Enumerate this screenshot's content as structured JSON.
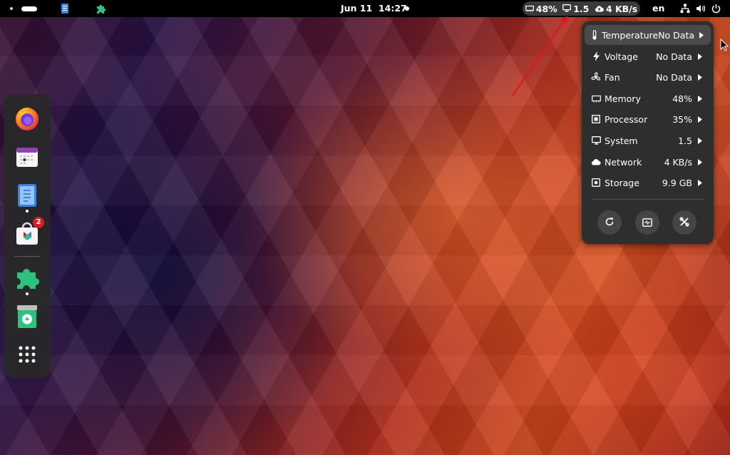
{
  "topbar": {
    "clock_date": "Jun 11",
    "clock_time": "14:27",
    "monitor": {
      "memory": "48%",
      "system": "1.5",
      "network": "4 KB/s"
    },
    "language": "en",
    "icons": [
      "workspace-indicator",
      "document-scanner-icon",
      "puzzle-icon",
      "memory-icon",
      "monitor-icon",
      "cloud-icon",
      "network-icon",
      "volume-icon",
      "power-icon"
    ]
  },
  "dock": {
    "apps": [
      {
        "name": "firefox-icon",
        "running": false
      },
      {
        "name": "calendar-icon",
        "running": false
      },
      {
        "name": "document-scanner-icon",
        "running": true
      },
      {
        "name": "software-store-icon",
        "running": false,
        "badge": "2"
      },
      {
        "name": "extensions-icon",
        "running": true
      },
      {
        "name": "trash-icon",
        "running": false
      },
      {
        "name": "app-grid-icon",
        "running": false
      }
    ]
  },
  "menu": {
    "rows": [
      {
        "label": "Temperature",
        "value": "No Data",
        "icon": "thermometer-icon"
      },
      {
        "label": "Voltage",
        "value": "No Data",
        "icon": "bolt-icon"
      },
      {
        "label": "Fan",
        "value": "No Data",
        "icon": "fan-icon"
      },
      {
        "label": "Memory",
        "value": "48%",
        "icon": "memory-icon"
      },
      {
        "label": "Processor",
        "value": "35%",
        "icon": "cpu-icon"
      },
      {
        "label": "System",
        "value": "1.5",
        "icon": "monitor-icon"
      },
      {
        "label": "Network",
        "value": "4 KB/s",
        "icon": "cloud-icon"
      },
      {
        "label": "Storage",
        "value": "9.9 GB",
        "icon": "disk-icon"
      }
    ],
    "buttons": [
      "refresh-icon",
      "system-monitor-icon",
      "preferences-icon"
    ]
  },
  "colors": {
    "topbar_bg": "#000000",
    "menu_bg": "#2e2e2e",
    "menu_hover": "#4a4a4a",
    "badge": "#e01b24",
    "arrow": "#e0141e"
  }
}
